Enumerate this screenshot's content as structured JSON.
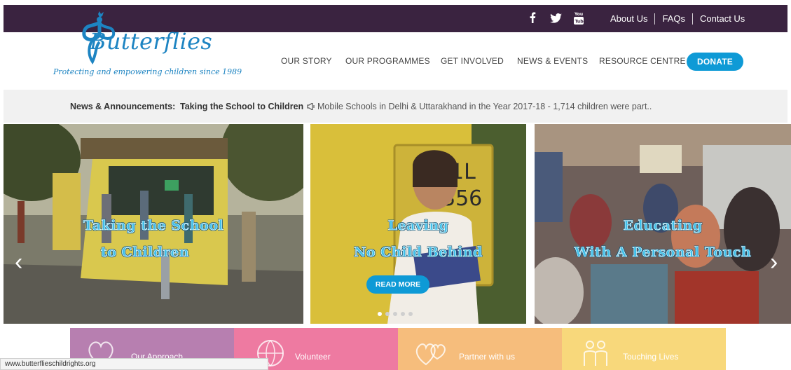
{
  "topbar": {
    "social": [
      "facebook-icon",
      "twitter-icon",
      "youtube-icon"
    ],
    "links": [
      "About Us",
      "FAQs",
      "Contact Us"
    ]
  },
  "logo": {
    "title": "Butterflies",
    "tagline": "Protecting and empowering children since 1989"
  },
  "nav": {
    "items": [
      "OUR STORY",
      "OUR PROGRAMMES",
      "GET INVOLVED",
      "NEWS & EVENTS",
      "RESOURCE CENTRE"
    ],
    "donate": "DONATE"
  },
  "news": {
    "label": "News & Announcements:",
    "headline": "Taking the School to Children",
    "text": "Mobile Schools in Delhi & Uttarakhand in the Year 2017-18 - 1,714 children were part.."
  },
  "slides": [
    {
      "line1": "Taking the School",
      "line2": "to Children"
    },
    {
      "line1": "Leaving",
      "line2": "No Child Behind",
      "button": "READ MORE"
    },
    {
      "line1": "Educating",
      "line2": "With A Personal Touch"
    }
  ],
  "tiles": [
    "Our Approach",
    "Volunteer",
    "Partner with us",
    "Touching Lives"
  ],
  "colors": {
    "topbar": "#3a2340",
    "brand_blue": "#1d84c2",
    "donate": "#0e9ad6",
    "tile_approach": "#b77fb0",
    "tile_volunteer": "#ee7aa1",
    "tile_partner": "#f6bd7c",
    "tile_touching": "#f8d87b"
  },
  "status": "www.butterflieschildrights.org"
}
